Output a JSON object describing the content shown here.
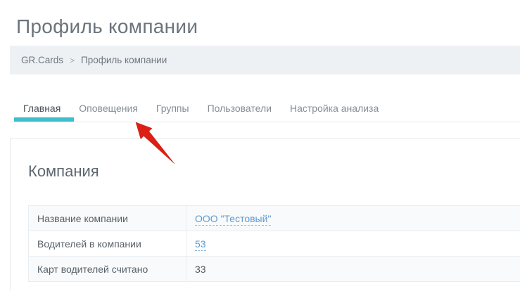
{
  "page_title": "Профиль компании",
  "breadcrumb": {
    "home": "GR.Cards",
    "separator": ">",
    "current": "Профиль компании"
  },
  "tabs": [
    "Главная",
    "Оповещения",
    "Группы",
    "Пользователи",
    "Настройка анализа"
  ],
  "active_tab": "Главная",
  "section": {
    "heading": "Компания",
    "rows": [
      {
        "label": "Название компании",
        "value": "ООО \"Тестовый\""
      },
      {
        "label": "Водителей в компании",
        "value": "53"
      },
      {
        "label": "Карт водителей считано",
        "value": "33"
      }
    ]
  },
  "annotation": {
    "type": "red-arrow",
    "points_to": "Оповещения"
  },
  "colors": {
    "accent_teal": "#3ebfca",
    "link_blue": "#5e9bd1",
    "arrow_red": "#dc2015",
    "breadcrumb_bg": "#eef1f4",
    "border_gray": "#e9edf0"
  }
}
